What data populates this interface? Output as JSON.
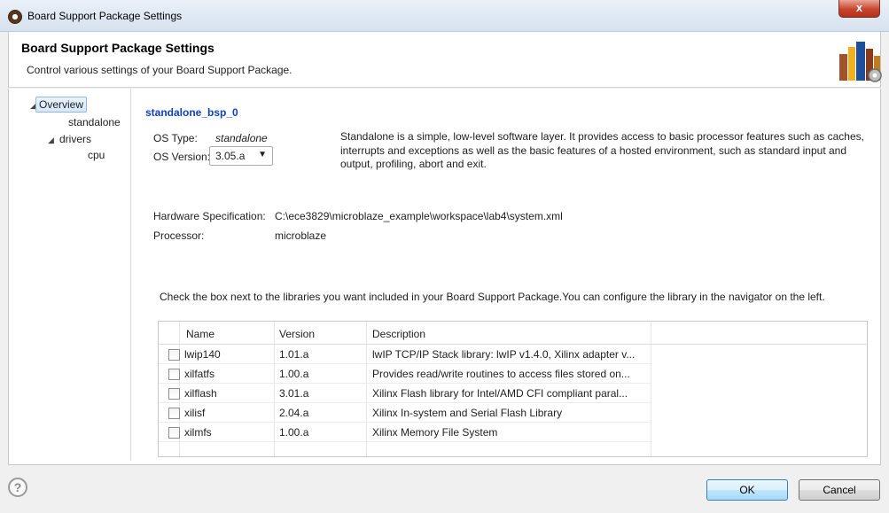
{
  "window": {
    "title": "Board Support Package Settings",
    "close_label": "x"
  },
  "header": {
    "title": "Board Support Package Settings",
    "subtitle": "Control various settings of your Board Support Package."
  },
  "tree": {
    "items": [
      {
        "label": "Overview",
        "selected": true
      },
      {
        "label": "standalone"
      },
      {
        "label": "drivers",
        "expanded": true
      },
      {
        "label": "cpu"
      }
    ]
  },
  "main": {
    "bsp_name": "standalone_bsp_0",
    "os_type_label": "OS Type:",
    "os_type_value": "standalone",
    "os_version_label": "OS Version:",
    "os_version_value": "3.05.a",
    "description": "Standalone is a simple, low-level software layer. It provides access to basic processor features such as caches, interrupts and exceptions as well as the basic features of a hosted environment, such as standard input and output, profiling, abort and exit.",
    "hw_spec_label": "Hardware Specification:",
    "hw_spec_value": "C:\\ece3829\\microblaze_example\\workspace\\lab4\\system.xml",
    "processor_label": "Processor:",
    "processor_value": "microblaze",
    "instructions": "Check the box next to the libraries you want included in your Board Support Package.You can configure the library in the navigator on the left."
  },
  "libraries": {
    "columns": [
      "Name",
      "Version",
      "Description"
    ],
    "rows": [
      {
        "name": "lwip140",
        "version": "1.01.a",
        "description": "lwIP TCP/IP Stack library: lwIP v1.4.0, Xilinx adapter v...",
        "checked": false
      },
      {
        "name": "xilfatfs",
        "version": "1.00.a",
        "description": "Provides read/write routines to access files stored on...",
        "checked": false
      },
      {
        "name": "xilflash",
        "version": "3.01.a",
        "description": "Xilinx Flash library for Intel/AMD CFI compliant paral...",
        "checked": false
      },
      {
        "name": "xilisf",
        "version": "2.04.a",
        "description": "Xilinx In-system and Serial Flash Library",
        "checked": false
      },
      {
        "name": "xilmfs",
        "version": "1.00.a",
        "description": "Xilinx Memory File System",
        "checked": false
      }
    ]
  },
  "footer": {
    "help_label": "?",
    "ok_label": "OK",
    "cancel_label": "Cancel"
  },
  "icons": {
    "app": "sdk-gear-icon",
    "banner": "bookshelf-gear-icon",
    "help": "help-icon"
  },
  "colors": {
    "link_blue": "#0f40c0",
    "close_red": "#c7452e"
  }
}
